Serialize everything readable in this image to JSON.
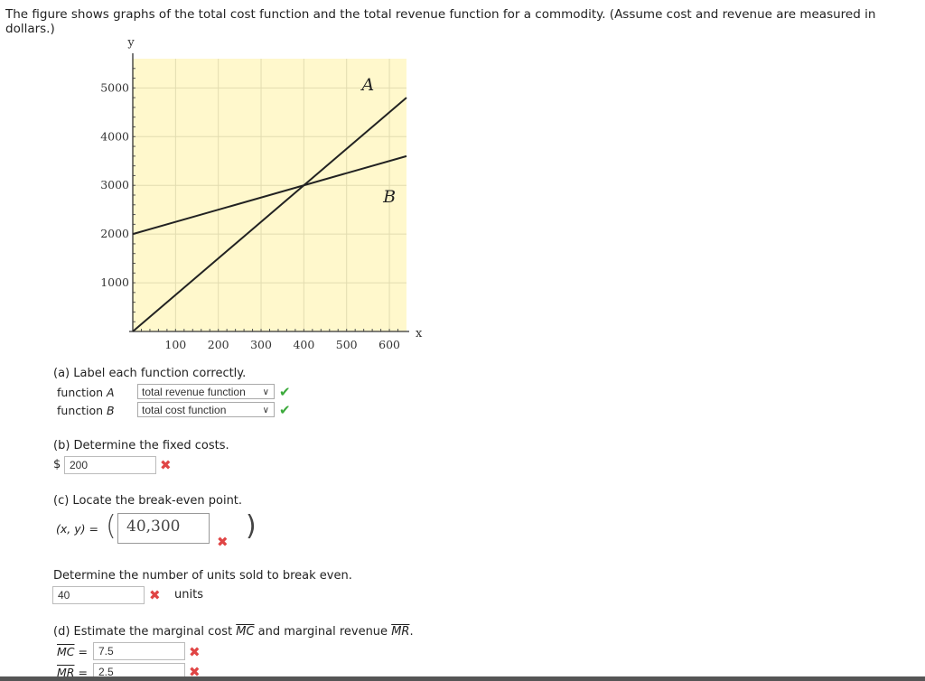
{
  "intro": "The figure shows graphs of the total cost function and the total revenue function for a commodity. (Assume cost and revenue are measured in dollars.)",
  "chart_data": {
    "type": "line",
    "xlabel": "x",
    "ylabel": "y",
    "xlim": [
      0,
      640
    ],
    "ylim": [
      0,
      5600
    ],
    "xticks": [
      100,
      200,
      300,
      400,
      500,
      600
    ],
    "yticks": [
      1000,
      2000,
      3000,
      4000,
      5000
    ],
    "grid": true,
    "background": "#fff8cc",
    "series": [
      {
        "name": "A",
        "x": [
          0,
          640
        ],
        "y": [
          0,
          4800
        ]
      },
      {
        "name": "B",
        "x": [
          0,
          640
        ],
        "y": [
          2000,
          3600
        ]
      }
    ]
  },
  "part_a": {
    "prompt": "(a) Label each function correctly.",
    "rows": [
      {
        "label": "function",
        "var": "A",
        "value": "total revenue function",
        "status": "correct"
      },
      {
        "label": "function",
        "var": "B",
        "value": "total cost function",
        "status": "correct"
      }
    ]
  },
  "part_b": {
    "prompt": "(b) Determine the fixed costs.",
    "prefix": "$",
    "value": "200",
    "status": "incorrect"
  },
  "part_c": {
    "prompt": "(c) Locate the break-even point.",
    "xy_label": "(x, y) =",
    "value": "40,300",
    "status": "incorrect",
    "units_prompt": "Determine the number of units sold to break even.",
    "units_value": "40",
    "units_status": "incorrect",
    "units_label": "units"
  },
  "part_d": {
    "prompt_pre": "(d) Estimate the marginal cost",
    "mc": "MC",
    "prompt_mid": "and marginal revenue",
    "mr": "MR",
    "mc_value": "7.5",
    "mr_value": "2.5",
    "mc_status": "incorrect",
    "mr_status": "incorrect"
  },
  "icons": {
    "correct": "✔",
    "incorrect": "✖",
    "chevron": "∨"
  }
}
